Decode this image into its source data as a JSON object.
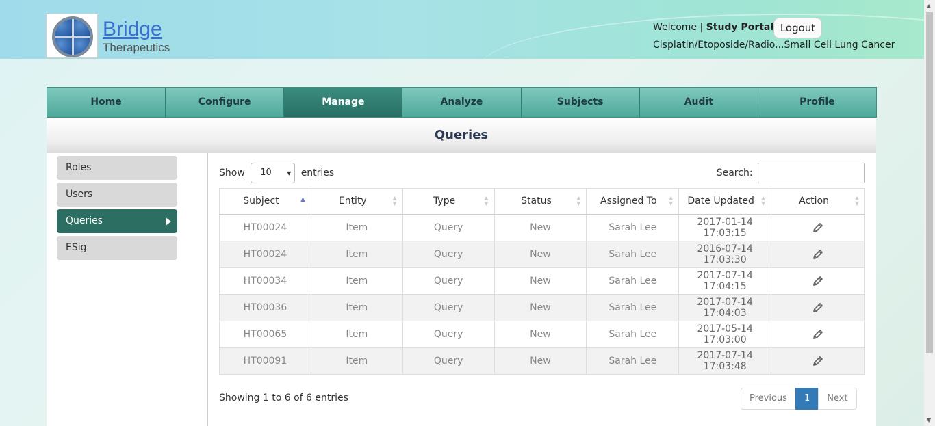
{
  "header": {
    "logo_title": "Bridge",
    "logo_subtitle": "Therapeutics",
    "welcome_label": "Welcome |",
    "portal_name": "Study Portal",
    "logout_label": "Logout",
    "study_name": "Cisplatin/Etoposide/Radio...Small Cell Lung Cancer"
  },
  "nav": {
    "tabs": [
      {
        "label": "Home"
      },
      {
        "label": "Configure"
      },
      {
        "label": "Manage"
      },
      {
        "label": "Analyze"
      },
      {
        "label": "Subjects"
      },
      {
        "label": "Audit"
      },
      {
        "label": "Profile"
      }
    ],
    "active": "Manage"
  },
  "page_title": "Queries",
  "sidebar": {
    "items": [
      {
        "label": "Roles"
      },
      {
        "label": "Users"
      },
      {
        "label": "Queries"
      },
      {
        "label": "ESig"
      }
    ],
    "active": "Queries"
  },
  "table_controls": {
    "show_label": "Show",
    "entries_value": "10",
    "entries_label": "entries",
    "search_label": "Search:",
    "search_value": ""
  },
  "table": {
    "columns": [
      "Subject",
      "Entity",
      "Type",
      "Status",
      "Assigned To",
      "Date Updated",
      "Action"
    ],
    "sorted_column": "Subject",
    "rows": [
      {
        "subject": "HT00024",
        "entity": "Item",
        "type": "Query",
        "status": "New",
        "assigned": "Sarah Lee",
        "date": "2017-01-14 17:03:15"
      },
      {
        "subject": "HT00024",
        "entity": "Item",
        "type": "Query",
        "status": "New",
        "assigned": "Sarah Lee",
        "date": "2016-07-14 17:03:30"
      },
      {
        "subject": "HT00034",
        "entity": "Item",
        "type": "Query",
        "status": "New",
        "assigned": "Sarah Lee",
        "date": "2017-07-14 17:04:15"
      },
      {
        "subject": "HT00036",
        "entity": "Item",
        "type": "Query",
        "status": "New",
        "assigned": "Sarah Lee",
        "date": "2017-07-14 17:04:03"
      },
      {
        "subject": "HT00065",
        "entity": "Item",
        "type": "Query",
        "status": "New",
        "assigned": "Sarah Lee",
        "date": "2017-05-14 17:03:00"
      },
      {
        "subject": "HT00091",
        "entity": "Item",
        "type": "Query",
        "status": "New",
        "assigned": "Sarah Lee",
        "date": "2017-07-14 17:03:48"
      }
    ]
  },
  "footer": {
    "info": "Showing 1 to 6 of 6 entries",
    "previous_label": "Previous",
    "current_page": "1",
    "next_label": "Next"
  },
  "colors": {
    "nav_active": "#2a6f64",
    "pager_current": "#337ab7",
    "logo_blue": "#3a6fd0"
  }
}
